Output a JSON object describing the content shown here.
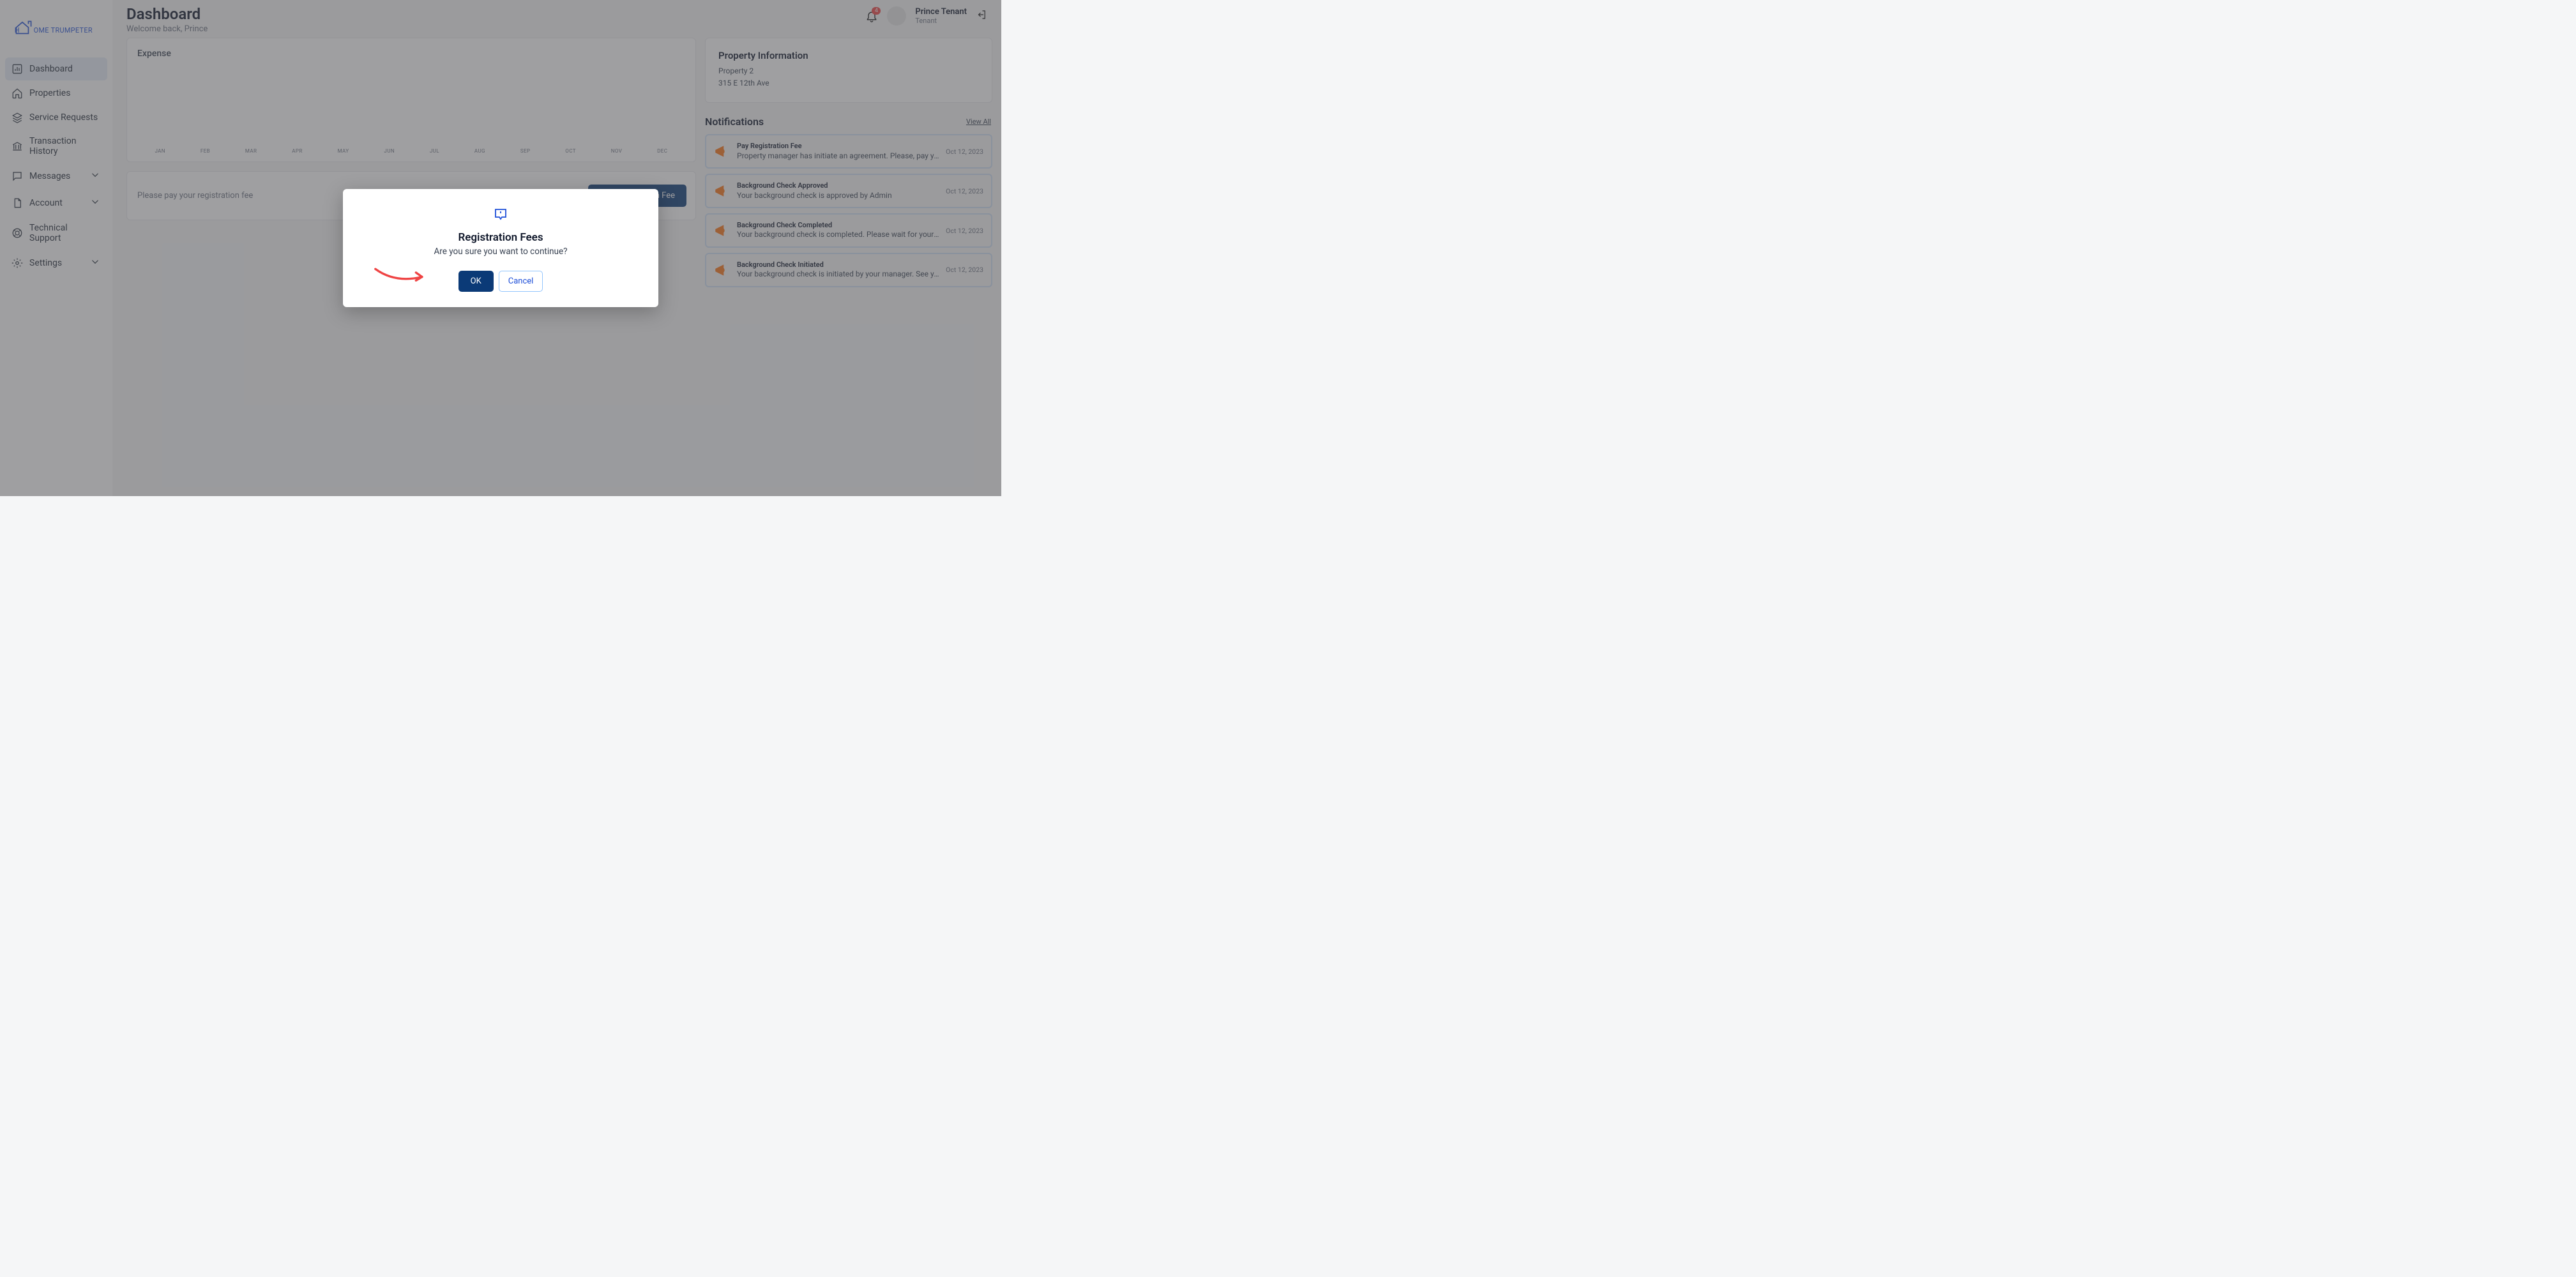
{
  "page": {
    "title": "Dashboard",
    "welcome": "Welcome back, Prince"
  },
  "brand": {
    "name": "Home Trumpeter"
  },
  "user": {
    "name": "Prince Tenant",
    "role": "Tenant",
    "notif_count": "4"
  },
  "sidebar": {
    "items": [
      {
        "label": "Dashboard",
        "icon": "chart-icon",
        "active": true
      },
      {
        "label": "Properties",
        "icon": "home-icon"
      },
      {
        "label": "Service Requests",
        "icon": "layers-icon"
      },
      {
        "label": "Transaction History",
        "icon": "bank-icon"
      },
      {
        "label": "Messages",
        "icon": "chat-icon",
        "expandable": true
      },
      {
        "label": "Account",
        "icon": "file-icon",
        "expandable": true
      },
      {
        "label": "Technical Support",
        "icon": "support-icon"
      },
      {
        "label": "Settings",
        "icon": "gear-icon",
        "expandable": true
      }
    ]
  },
  "chart_data": {
    "type": "bar",
    "title": "Expense",
    "categories": [
      "JAN",
      "FEB",
      "MAR",
      "APR",
      "MAY",
      "JUN",
      "JUL",
      "AUG",
      "SEP",
      "OCT",
      "NOV",
      "DEC"
    ],
    "values": [
      0,
      0,
      0,
      0,
      0,
      0,
      0,
      0,
      0,
      0,
      0,
      0
    ],
    "xlabel": "",
    "ylabel": "",
    "ylim": [
      0,
      0
    ]
  },
  "pay_bar": {
    "text": "Please pay your registration fee",
    "button": "Pay Registration Fee"
  },
  "property": {
    "title": "Property Information",
    "name": "Property 2",
    "address": "315 E 12th Ave"
  },
  "notifications": {
    "heading": "Notifications",
    "view_all": "View All",
    "items": [
      {
        "title": "Pay Registration Fee",
        "body": "Property manager has initiate an agreement. Please, pay your registration fe...",
        "date": "Oct 12, 2023"
      },
      {
        "title": "Background Check Approved",
        "body": "Your background check is approved by Admin",
        "date": "Oct 12, 2023"
      },
      {
        "title": "Background Check Completed",
        "body": "Your background check is completed. Please wait for your manager approval.",
        "date": "Oct 12, 2023"
      },
      {
        "title": "Background Check Initiated",
        "body": "Your background check is initiated by your manager. See your email for furt...",
        "date": "Oct 12, 2023"
      }
    ]
  },
  "modal": {
    "title": "Registration Fees",
    "body": "Are you sure you want to continue?",
    "ok": "OK",
    "cancel": "Cancel"
  }
}
